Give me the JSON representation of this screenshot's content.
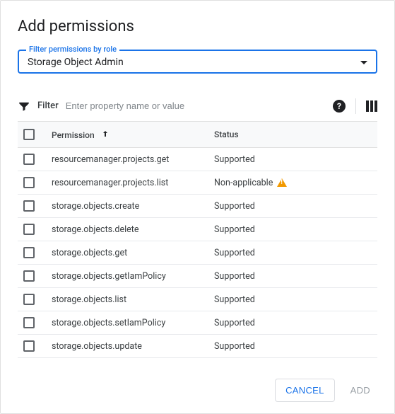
{
  "title": "Add permissions",
  "filter_select": {
    "label": "Filter permissions by role",
    "value": "Storage Object Admin"
  },
  "toolbar": {
    "filter_label": "Filter",
    "filter_placeholder": "Enter property name or value"
  },
  "table": {
    "headers": {
      "permission": "Permission",
      "status": "Status"
    },
    "rows": [
      {
        "permission": "resourcemanager.projects.get",
        "status": "Supported",
        "warn": false
      },
      {
        "permission": "resourcemanager.projects.list",
        "status": "Non-applicable",
        "warn": true
      },
      {
        "permission": "storage.objects.create",
        "status": "Supported",
        "warn": false
      },
      {
        "permission": "storage.objects.delete",
        "status": "Supported",
        "warn": false
      },
      {
        "permission": "storage.objects.get",
        "status": "Supported",
        "warn": false
      },
      {
        "permission": "storage.objects.getIamPolicy",
        "status": "Supported",
        "warn": false
      },
      {
        "permission": "storage.objects.list",
        "status": "Supported",
        "warn": false
      },
      {
        "permission": "storage.objects.setIamPolicy",
        "status": "Supported",
        "warn": false
      },
      {
        "permission": "storage.objects.update",
        "status": "Supported",
        "warn": false
      }
    ]
  },
  "actions": {
    "cancel": "CANCEL",
    "add": "ADD"
  }
}
